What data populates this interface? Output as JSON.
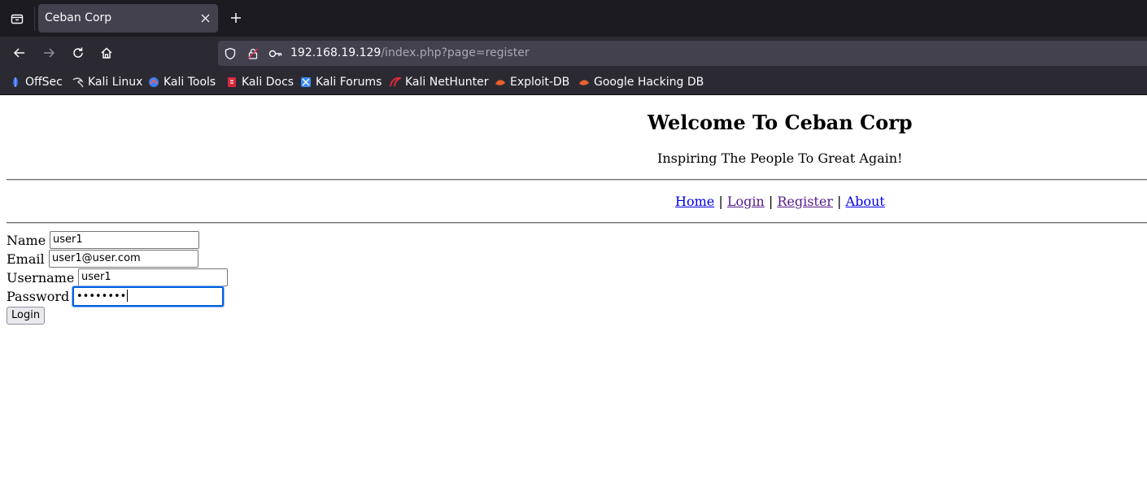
{
  "browser": {
    "tab": {
      "title": "Ceban Corp",
      "close_icon": "close-icon"
    },
    "url": {
      "host": "192.168.19.129",
      "path": "/index.php?page=register"
    },
    "bookmarks": [
      {
        "label": "OffSec",
        "icon": "offsec-icon",
        "color": "#3a6ee8"
      },
      {
        "label": "Kali Linux",
        "icon": "kali-dragon-icon",
        "color": "#c8c8c8"
      },
      {
        "label": "Kali Tools",
        "icon": "kali-tools-icon",
        "color": "#3a7ff0"
      },
      {
        "label": "Kali Docs",
        "icon": "kali-docs-icon",
        "color": "#d6293a"
      },
      {
        "label": "Kali Forums",
        "icon": "kali-forums-icon",
        "color": "#3a8bff"
      },
      {
        "label": "Kali NetHunter",
        "icon": "nethunter-icon",
        "color": "#e0283a"
      },
      {
        "label": "Exploit-DB",
        "icon": "exploit-db-icon",
        "color": "#e8602c"
      },
      {
        "label": "Google Hacking DB",
        "icon": "ghdb-icon",
        "color": "#e8602c"
      }
    ]
  },
  "page": {
    "title": "Welcome To Ceban Corp",
    "tagline": "Inspiring The People To Great Again!",
    "menu": {
      "home": "Home",
      "login": "Login",
      "register": "Register",
      "about": "About",
      "separator": "|"
    },
    "form": {
      "name_label": "Name",
      "name_value": "user1",
      "email_label": "Email",
      "email_value": "user1@user.com",
      "username_label": "Username",
      "username_value": "user1",
      "password_label": "Password",
      "password_value": "••••••••",
      "submit_label": "Login"
    }
  }
}
